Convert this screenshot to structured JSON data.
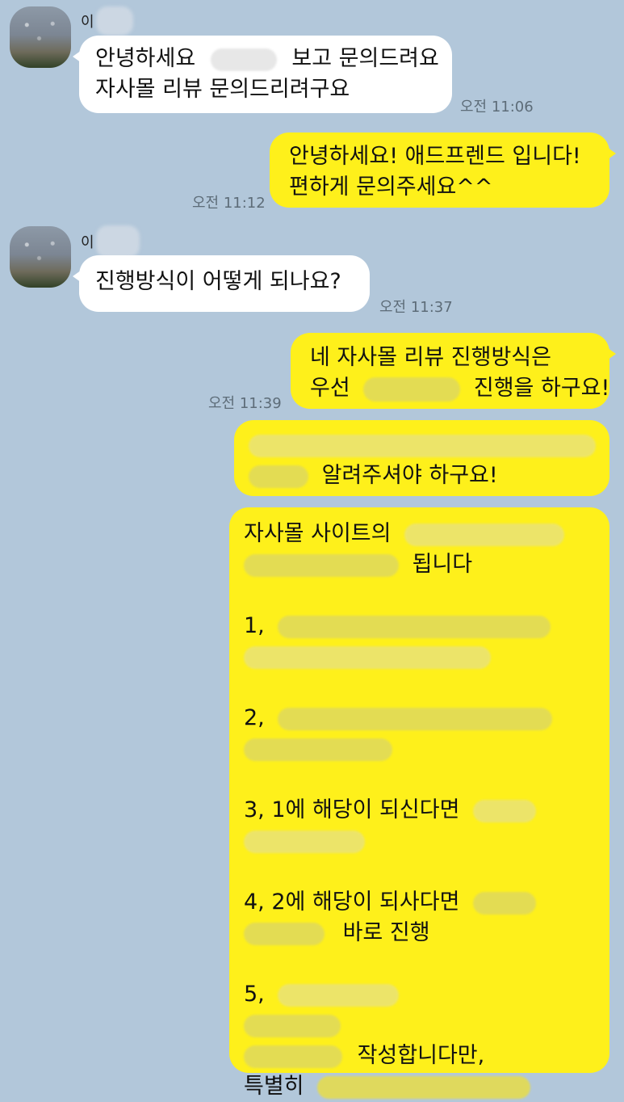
{
  "chat": {
    "messages": [
      {
        "sender": "이",
        "text_line1_part1": "안녕하세요",
        "text_line1_part2": "보고 문의드려요",
        "text_line2": "자사몰 리뷰 문의드리려구요",
        "time": "오전 11:06"
      },
      {
        "text_line1": "안녕하세요! 애드프렌드 입니다!",
        "text_line2": "편하게 문의주세요^^",
        "time": "오전 11:12"
      },
      {
        "sender": "이",
        "text": "진행방식이 어떻게 되나요?",
        "time": "오전 11:37"
      },
      {
        "text_line1": "네 자사몰 리뷰 진행방식은",
        "text_line2_part1": "우선",
        "text_line2_part2": "진행을 하구요!",
        "time": "오전 11:39"
      },
      {
        "text_line2": "알려주셔야 하구요!"
      },
      {
        "line1": "자사몰 사이트의",
        "line2": "됩니다",
        "item1": "1,",
        "item2": "2,",
        "item3": "3, 1에 해당이 되신다면",
        "item4": "4, 2에 해당이 되사다면",
        "item4_line2": "바로 진행",
        "item5": "5,",
        "item5_line3": "작성합니다만,",
        "item5_line4": "특별히"
      }
    ]
  }
}
